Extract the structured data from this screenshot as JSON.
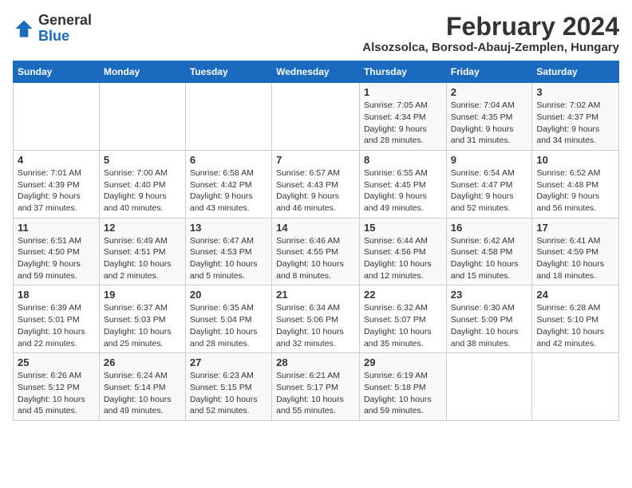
{
  "logo": {
    "line1": "General",
    "line2": "Blue"
  },
  "title": "February 2024",
  "subtitle": "Alsozsolca, Borsod-Abauj-Zemplen, Hungary",
  "days_of_week": [
    "Sunday",
    "Monday",
    "Tuesday",
    "Wednesday",
    "Thursday",
    "Friday",
    "Saturday"
  ],
  "weeks": [
    [
      {
        "day": "",
        "detail": ""
      },
      {
        "day": "",
        "detail": ""
      },
      {
        "day": "",
        "detail": ""
      },
      {
        "day": "",
        "detail": ""
      },
      {
        "day": "1",
        "detail": "Sunrise: 7:05 AM\nSunset: 4:34 PM\nDaylight: 9 hours and 28 minutes."
      },
      {
        "day": "2",
        "detail": "Sunrise: 7:04 AM\nSunset: 4:35 PM\nDaylight: 9 hours and 31 minutes."
      },
      {
        "day": "3",
        "detail": "Sunrise: 7:02 AM\nSunset: 4:37 PM\nDaylight: 9 hours and 34 minutes."
      }
    ],
    [
      {
        "day": "4",
        "detail": "Sunrise: 7:01 AM\nSunset: 4:39 PM\nDaylight: 9 hours and 37 minutes."
      },
      {
        "day": "5",
        "detail": "Sunrise: 7:00 AM\nSunset: 4:40 PM\nDaylight: 9 hours and 40 minutes."
      },
      {
        "day": "6",
        "detail": "Sunrise: 6:58 AM\nSunset: 4:42 PM\nDaylight: 9 hours and 43 minutes."
      },
      {
        "day": "7",
        "detail": "Sunrise: 6:57 AM\nSunset: 4:43 PM\nDaylight: 9 hours and 46 minutes."
      },
      {
        "day": "8",
        "detail": "Sunrise: 6:55 AM\nSunset: 4:45 PM\nDaylight: 9 hours and 49 minutes."
      },
      {
        "day": "9",
        "detail": "Sunrise: 6:54 AM\nSunset: 4:47 PM\nDaylight: 9 hours and 52 minutes."
      },
      {
        "day": "10",
        "detail": "Sunrise: 6:52 AM\nSunset: 4:48 PM\nDaylight: 9 hours and 56 minutes."
      }
    ],
    [
      {
        "day": "11",
        "detail": "Sunrise: 6:51 AM\nSunset: 4:50 PM\nDaylight: 9 hours and 59 minutes."
      },
      {
        "day": "12",
        "detail": "Sunrise: 6:49 AM\nSunset: 4:51 PM\nDaylight: 10 hours and 2 minutes."
      },
      {
        "day": "13",
        "detail": "Sunrise: 6:47 AM\nSunset: 4:53 PM\nDaylight: 10 hours and 5 minutes."
      },
      {
        "day": "14",
        "detail": "Sunrise: 6:46 AM\nSunset: 4:55 PM\nDaylight: 10 hours and 8 minutes."
      },
      {
        "day": "15",
        "detail": "Sunrise: 6:44 AM\nSunset: 4:56 PM\nDaylight: 10 hours and 12 minutes."
      },
      {
        "day": "16",
        "detail": "Sunrise: 6:42 AM\nSunset: 4:58 PM\nDaylight: 10 hours and 15 minutes."
      },
      {
        "day": "17",
        "detail": "Sunrise: 6:41 AM\nSunset: 4:59 PM\nDaylight: 10 hours and 18 minutes."
      }
    ],
    [
      {
        "day": "18",
        "detail": "Sunrise: 6:39 AM\nSunset: 5:01 PM\nDaylight: 10 hours and 22 minutes."
      },
      {
        "day": "19",
        "detail": "Sunrise: 6:37 AM\nSunset: 5:03 PM\nDaylight: 10 hours and 25 minutes."
      },
      {
        "day": "20",
        "detail": "Sunrise: 6:35 AM\nSunset: 5:04 PM\nDaylight: 10 hours and 28 minutes."
      },
      {
        "day": "21",
        "detail": "Sunrise: 6:34 AM\nSunset: 5:06 PM\nDaylight: 10 hours and 32 minutes."
      },
      {
        "day": "22",
        "detail": "Sunrise: 6:32 AM\nSunset: 5:07 PM\nDaylight: 10 hours and 35 minutes."
      },
      {
        "day": "23",
        "detail": "Sunrise: 6:30 AM\nSunset: 5:09 PM\nDaylight: 10 hours and 38 minutes."
      },
      {
        "day": "24",
        "detail": "Sunrise: 6:28 AM\nSunset: 5:10 PM\nDaylight: 10 hours and 42 minutes."
      }
    ],
    [
      {
        "day": "25",
        "detail": "Sunrise: 6:26 AM\nSunset: 5:12 PM\nDaylight: 10 hours and 45 minutes."
      },
      {
        "day": "26",
        "detail": "Sunrise: 6:24 AM\nSunset: 5:14 PM\nDaylight: 10 hours and 49 minutes."
      },
      {
        "day": "27",
        "detail": "Sunrise: 6:23 AM\nSunset: 5:15 PM\nDaylight: 10 hours and 52 minutes."
      },
      {
        "day": "28",
        "detail": "Sunrise: 6:21 AM\nSunset: 5:17 PM\nDaylight: 10 hours and 55 minutes."
      },
      {
        "day": "29",
        "detail": "Sunrise: 6:19 AM\nSunset: 5:18 PM\nDaylight: 10 hours and 59 minutes."
      },
      {
        "day": "",
        "detail": ""
      },
      {
        "day": "",
        "detail": ""
      }
    ]
  ]
}
